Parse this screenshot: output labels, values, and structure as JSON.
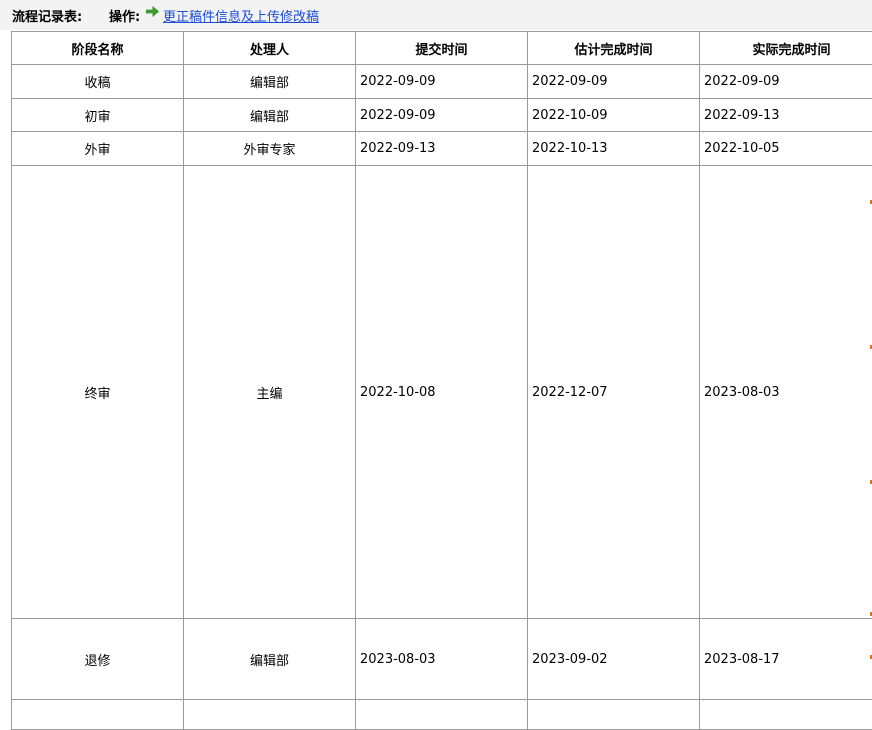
{
  "header": {
    "title": "流程记录表:",
    "operation_label": "操作:",
    "operation_icon": "green-arrow-icon",
    "operation_link": "更正稿件信息及上传修改稿"
  },
  "table": {
    "columns": [
      "阶段名称",
      "处理人",
      "提交时间",
      "估计完成时间",
      "实际完成时间"
    ],
    "rows": [
      {
        "stage": "收稿",
        "handler": "编辑部",
        "submitted": "2022-09-09",
        "estimated": "2022-09-09",
        "actual": "2022-09-09"
      },
      {
        "stage": "初审",
        "handler": "编辑部",
        "submitted": "2022-09-09",
        "estimated": "2022-10-09",
        "actual": "2022-09-13"
      },
      {
        "stage": "外审",
        "handler": "外审专家",
        "submitted": "2022-09-13",
        "estimated": "2022-10-13",
        "actual": "2022-10-05"
      },
      {
        "stage": "终审",
        "handler": "主编",
        "submitted": "2022-10-08",
        "estimated": "2022-12-07",
        "actual": "2023-08-03"
      },
      {
        "stage": "退修",
        "handler": "编辑部",
        "submitted": "2023-08-03",
        "estimated": "2023-09-02",
        "actual": "2023-08-17"
      },
      {
        "stage": "",
        "handler": "",
        "submitted": "",
        "estimated": "",
        "actual": ""
      }
    ]
  },
  "colors": {
    "link": "#1a4cd6",
    "border": "#9a9a9a",
    "topbar_bg": "#f3f3f3",
    "arrow": "#3a9a2a"
  }
}
